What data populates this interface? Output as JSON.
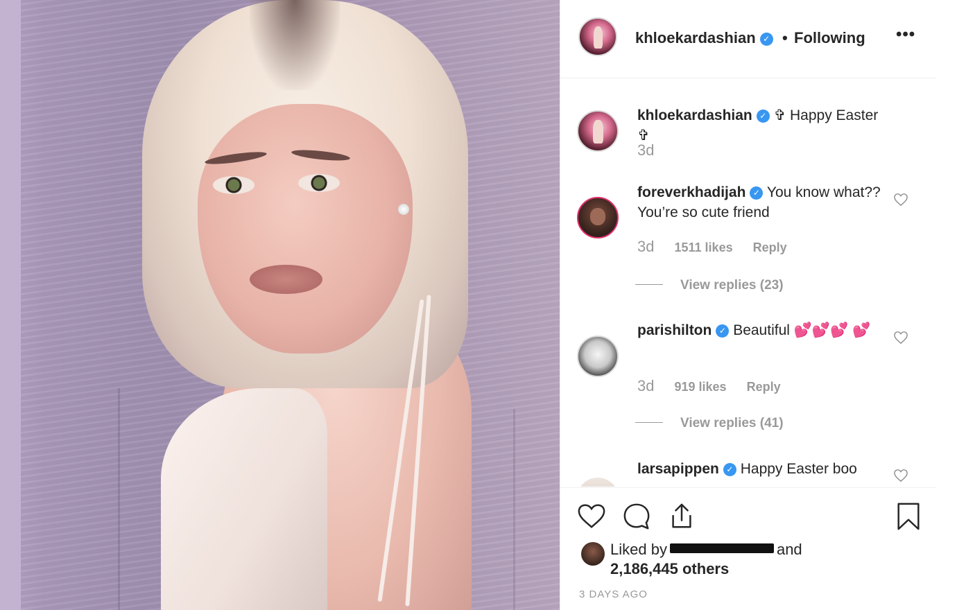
{
  "post": {
    "username": "khloekardashian",
    "dot": "•",
    "follow_label": "Following",
    "more_label": "•••",
    "verified_glyph": "✓"
  },
  "comments": [
    {
      "username": "khloekardashian",
      "text": "✞ Happy Easter ✞",
      "time": "3d"
    },
    {
      "username": "foreverkhadijah",
      "text": "You know what?? You’re so cute friend",
      "time": "3d",
      "likes": "1511 likes",
      "reply": "Reply",
      "view_replies": "View replies (23)"
    },
    {
      "username": "parishilton",
      "text": "Beautiful 💕💕💕 💕",
      "time": "3d",
      "likes": "919 likes",
      "reply": "Reply",
      "view_replies": "View replies (41)"
    },
    {
      "username": "larsapippen",
      "text": "Happy Easter boo"
    }
  ],
  "footer": {
    "liked_by_prefix": "Liked by",
    "liked_by_suffix": "and",
    "others": "2,186,445 others",
    "time_ago": "3 DAYS AGO"
  },
  "icons": [
    "heart-icon",
    "comment-icon",
    "share-icon",
    "bookmark-icon",
    "more-icon",
    "verified-icon"
  ],
  "colors": {
    "verified": "#3897f0",
    "muted": "#999999",
    "text": "#262626"
  }
}
